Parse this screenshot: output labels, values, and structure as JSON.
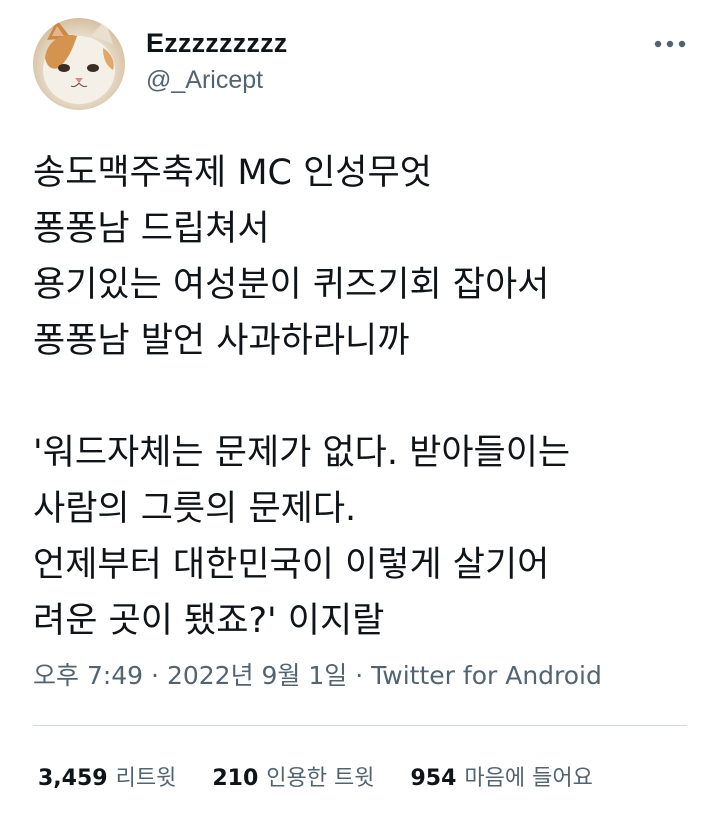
{
  "author": {
    "display_name": "Ezzzzzzzzz",
    "handle": "@_Aricept"
  },
  "tweet": {
    "lines": [
      "송도맥주축제 MC 인성무엇",
      "퐁퐁남 드립쳐서",
      "용기있는 여성분이 퀴즈기회 잡아서",
      "퐁퐁남 발언 사과하라니까",
      "",
      "'워드자체는 문제가 없다. 받아들이는",
      "사람의 그릇의 문제다.",
      "언제부터 대한민국이 이렇게 살기어",
      "려운 곳이 됐죠?' 이지랄"
    ]
  },
  "meta": {
    "time": "오후 7:49",
    "separator": "·",
    "date": "2022년 9월 1일",
    "source": "Twitter for Android"
  },
  "stats": {
    "retweets": {
      "count": "3,459",
      "label": "리트윗"
    },
    "quotes": {
      "count": "210",
      "label": "인용한 트윗"
    },
    "likes": {
      "count": "954",
      "label": "마음에 들어요"
    }
  },
  "colors": {
    "text": "#0f1419",
    "secondary": "#536471",
    "divider": "#cfd9de"
  },
  "icons": {
    "avatar": "cat-avatar",
    "more": "more-options-icon"
  }
}
